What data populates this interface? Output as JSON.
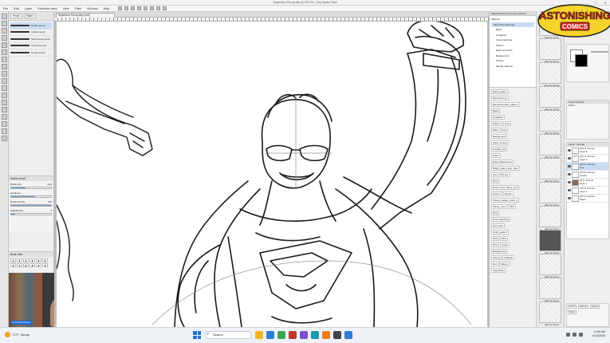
{
  "window": {
    "title": "Superhero Pin-up.clip @ 100.0% - Clip Studio Paint",
    "controls": [
      "–",
      "□",
      "✕"
    ]
  },
  "menu": [
    "File",
    "Edit",
    "Layer",
    "Selection area",
    "View",
    "Filter",
    "Window",
    "Help"
  ],
  "toolbox": {
    "tools": [
      "zoom-icon",
      "move-icon",
      "select-icon",
      "lasso-icon",
      "eyedropper-icon",
      "pen-icon",
      "pencil-icon",
      "brush-icon",
      "airbrush-icon",
      "eraser-icon",
      "blend-icon",
      "fill-icon",
      "gradient-icon",
      "figure-icon",
      "frame-icon",
      "text-icon",
      "balloon-icon",
      "ruler-icon"
    ]
  },
  "subtool": {
    "tabs": [
      "Pencil",
      "Pastel"
    ],
    "brushes": [
      "Darker pencil",
      "Lighter pencil",
      "Mechanical pencil",
      "Colored pencil",
      "Rough pencil"
    ],
    "selected_index": 0
  },
  "tool_property": {
    "header": "Darker pencil",
    "props": [
      {
        "label": "Brush size",
        "value": "10.0",
        "fill": 0.35
      },
      {
        "label": "Hardness",
        "value": "",
        "fill": 0.6
      },
      {
        "label": "Brush density",
        "value": "100",
        "fill": 1.0
      },
      {
        "label": "Stabilization",
        "value": "2",
        "fill": 0.1
      }
    ]
  },
  "brush_size_panel": {
    "header": "Brush Size"
  },
  "webcam": {
    "label": "www.astonishing..."
  },
  "canvas": {
    "tab_label": "Superhero Pin-up.clip (Line)"
  },
  "material": {
    "header": "Material [Monochromatic pattern]",
    "tree": [
      "Material",
      "Monochromatic pat...",
      "Basic",
      "Gradation",
      "Cross-hatching",
      "Pattern",
      "Effect and lines",
      "Background",
      "Texture",
      "Manga material"
    ],
    "selected_tree_index": 1,
    "chips": [
      [
        "Sand_pattern"
      ],
      [
        "Monochrome"
      ],
      [
        "Monochromatic_pattern"
      ],
      [
        "Basic"
      ],
      [
        "Gradation"
      ],
      [
        "Pattern",
        "Tone"
      ],
      [
        "Effect",
        "line"
      ],
      [
        "Background"
      ],
      [
        "Paper texture"
      ],
      [
        "Parallel_line"
      ],
      [
        "Gilder"
      ],
      [
        "Effect_Backround"
      ],
      [
        "Bright_Quiet_Soft_Tone"
      ],
      [
        "Line",
        "50 line"
      ],
      [
        "50%"
      ],
      [
        "Dark_Loud_Tense_Atm"
      ],
      [
        "Pattern",
        "Flower"
      ],
      [
        "Flower_pattern_plant_s"
      ],
      [
        "Vitride_tone",
        "50%"
      ],
      [
        "50%"
      ],
      [
        "Cross-hatching"
      ],
      [
        "Soft_Expl"
      ],
      [
        "Cloth_pattern"
      ],
      [
        "50%",
        "20%"
      ],
      [
        "50%",
        "Circle"
      ],
      [
        "Background"
      ],
      [
        "School",
        "Artificial"
      ],
      [
        "Dot",
        "Nature"
      ],
      [
        "Vegetation"
      ]
    ]
  },
  "thumbnails": [
    "SEG line 10 line",
    "SEG line 50 line",
    "SEG line 100 line",
    "SEG line 10 line",
    "SEG line 50 line",
    "SEG line 10 line",
    "SEG line 40 line",
    "SEG line 20 line",
    "SEG line 50 line",
    "SEG line 40 line",
    "SEG line 60 line",
    "SEG line 40 line",
    "SEG line 20 line"
  ],
  "brand": {
    "line1": "ASTONISHING",
    "line2": "COMICS"
  },
  "layer_property": {
    "header": "Layer Property",
    "effect": "Effect"
  },
  "layers": {
    "header": "Layer",
    "blend": "Normal",
    "items": [
      {
        "name": "100 %  Normal\nLayer 5",
        "img": false,
        "selected": false
      },
      {
        "name": "100 %  Normal\nLayer 2",
        "img": false,
        "selected": false
      },
      {
        "name": "100 %  Normal\nLine",
        "img": false,
        "selected": true
      },
      {
        "name": "100 %  Normal\npencils",
        "img": false,
        "selected": false
      },
      {
        "name": "30 %  Normal\nLayer 1",
        "img": true,
        "selected": false
      },
      {
        "name": "100 %  Normal\nLayer 4",
        "img": false,
        "selected": false
      },
      {
        "name": "100 %  Normal\nPaper",
        "img": false,
        "selected": false
      }
    ],
    "bottom_chips": [
      "100 %",
      "Normal",
      "Layer 3",
      "Paper"
    ]
  },
  "taskbar": {
    "weather_temp": "71°F",
    "weather_desc": "Sunny",
    "search_placeholder": "Search",
    "time": "11:59 AM",
    "date": "5/14/2023",
    "app_colors": [
      "#f0b429",
      "#2d7dd2",
      "#3aa655",
      "#c0392b",
      "#7b4fd6",
      "#1b9aaa",
      "#e67e22",
      "#444444",
      "#2d7dd2"
    ]
  },
  "colors": {
    "accent": "#1f73d6",
    "selection": "#c9dcf4",
    "brand_red": "#d8291d",
    "brand_yellow": "#f6d42b"
  }
}
